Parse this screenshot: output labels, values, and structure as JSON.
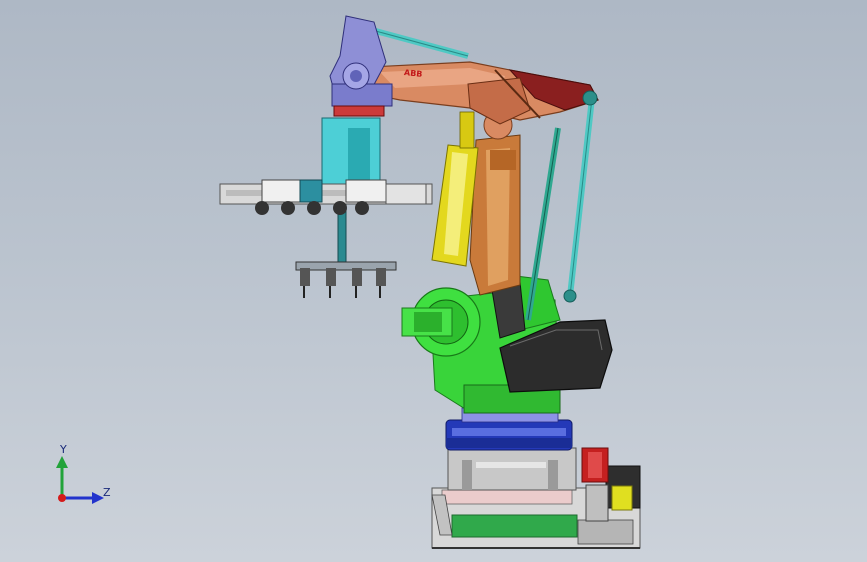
{
  "viewport": {
    "background": [
      "#aeb8c5",
      "#ccd2da"
    ]
  },
  "triad": {
    "y_label": "Y",
    "z_label": "Z",
    "y_color": "#22a33a",
    "z_color": "#2233cc",
    "origin_color": "#d41a1a"
  },
  "robot": {
    "brand_text": "ABB",
    "part_colors": {
      "arm": "#d98a62",
      "arm_dark": "#8a1f1f",
      "wrist": "#8e8fd6",
      "rods": "#4fc9c4",
      "cylinder": "#e3d81e",
      "gripper": "#4dcfd6",
      "lower_arm": "#c97a3a",
      "base": "#39d43a",
      "cover": "#2a2a2a",
      "turntable": "#2339b5",
      "frame": "#c9c9c9",
      "sled": "#2fa84a",
      "sled_top": "#e8c8c8",
      "motor_red": "#c52020",
      "motor_yellow": "#e0df20"
    }
  }
}
